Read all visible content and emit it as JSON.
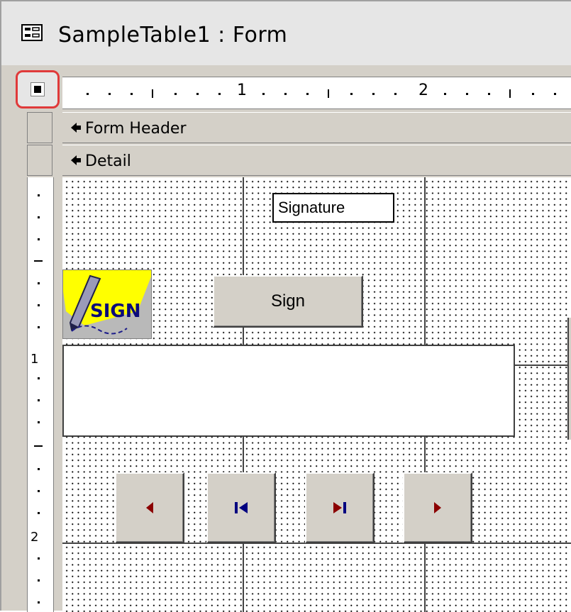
{
  "window": {
    "title": "SampleTable1 : Form",
    "title_icon": "form-icon"
  },
  "form_selector": {
    "icon": "form-selector-icon",
    "highlight_color": "#e03a3a"
  },
  "ruler": {
    "horizontal_labels": [
      "1",
      "2"
    ],
    "vertical_labels": [
      "1",
      "2"
    ]
  },
  "sections": {
    "form_header": "Form Header",
    "detail": "Detail"
  },
  "controls": {
    "signature_field": "Signature",
    "sign_image_text": "SIGN",
    "sign_button": "Sign",
    "nav_buttons": [
      {
        "name": "previous-record-button",
        "icon": "arrow-left-icon",
        "color": "#8b0000"
      },
      {
        "name": "first-record-button",
        "icon": "first-record-icon",
        "color": "#000080"
      },
      {
        "name": "last-record-button",
        "icon": "last-record-icon",
        "color": "#8b0000"
      },
      {
        "name": "next-record-button",
        "icon": "arrow-right-icon",
        "color": "#8b0000"
      }
    ]
  }
}
